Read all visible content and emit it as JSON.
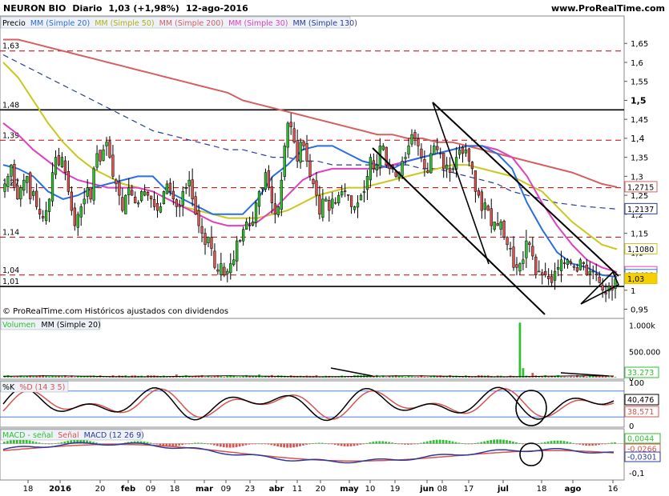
{
  "header": {
    "stock": "NEURON BIO",
    "period": "Diario",
    "quote": "1,03 (+1,98%)",
    "date": "12-ago-2016",
    "site": "www.ProRealTime.com"
  },
  "colors": {
    "up": "#2fbf2f",
    "down": "#d9534f",
    "ma20": "#2a6fe0",
    "ma50": "#c8c81e",
    "ma200": "#d46060",
    "ma30": "#e040c0",
    "ma130": "#2b3a9c",
    "level": "#c00000",
    "trend": "#000000"
  },
  "price_panel": {
    "legend": [
      "Precio",
      "MM (Simple 20)",
      "MM (Simple 50)",
      "MM (Simple 200)",
      "MM (Simple 30)",
      "MM (Simple 130)"
    ],
    "watermark": "© ProRealTime.com Históricos ajustados con dividendos",
    "levels": [
      {
        "label": "1,63",
        "value": 1.63,
        "style": "dashed"
      },
      {
        "label": "1,48",
        "value": 1.475,
        "style": "solid"
      },
      {
        "label": "1,39",
        "value": 1.395,
        "style": "dashed"
      },
      {
        "label": "1,27",
        "value": 1.27,
        "style": "dashed"
      },
      {
        "label": "1,14",
        "value": 1.14,
        "style": "dashed"
      },
      {
        "label": "1,04",
        "value": 1.04,
        "style": "dashed"
      },
      {
        "label": "1,01",
        "value": 1.01,
        "style": "solid"
      }
    ],
    "right_labels": [
      {
        "text": "1,2715",
        "value": 1.2715,
        "color": "#d46060"
      },
      {
        "text": "1,2137",
        "value": 1.2137,
        "color": "#2b3a9c"
      },
      {
        "text": "1,1080",
        "value": 1.108,
        "color": "#c8c81e"
      },
      {
        "text": "1,0477",
        "value": 1.0477,
        "color": "#e040c0"
      },
      {
        "text": "1,0400",
        "value": 1.04,
        "color": "#2a6fe0"
      },
      {
        "text": "1,03",
        "value": 1.03,
        "color": "#e8c000"
      }
    ]
  },
  "volume_panel": {
    "legend": [
      "Volumen",
      "MM (Simple 20)"
    ],
    "last": "33.273"
  },
  "stoch_panel": {
    "legend": [
      "%K",
      "%D (14 3 5)"
    ],
    "last_k": "40,476",
    "last_d": "38,571"
  },
  "macd_panel": {
    "legend": [
      "MACD - señal",
      "Señal",
      "MACD (12 26 9)"
    ],
    "hist_last": "0,0044",
    "signal_last": "-0,0266",
    "macd_last": "-0,0301"
  },
  "chart_data": [
    {
      "type": "candlestick",
      "title": "NEURON BIO Diario",
      "ylim": [
        0.93,
        1.68
      ],
      "yticks": [
        "1,65",
        "1,6",
        "1,55",
        "1,5",
        "1,45",
        "1,4",
        "1,35",
        "1,3",
        "1,25",
        "1,2",
        "1,15",
        "1,1",
        "1,05",
        "1",
        "0,95"
      ],
      "x_ticks": [
        "18",
        "2016",
        "20",
        "feb",
        "09",
        "18",
        "mar",
        "09",
        "23",
        "abr",
        "11",
        "20",
        "may",
        "10",
        "19",
        "jun",
        "08",
        "17",
        "jul",
        "18",
        "ago",
        "16"
      ],
      "close": [
        1.28,
        1.3,
        1.33,
        1.27,
        1.24,
        1.27,
        1.29,
        1.3,
        1.24,
        1.26,
        1.22,
        1.2,
        1.19,
        1.21,
        1.24,
        1.31,
        1.35,
        1.33,
        1.35,
        1.31,
        1.26,
        1.21,
        1.17,
        1.2,
        1.22,
        1.24,
        1.27,
        1.24,
        1.32,
        1.36,
        1.34,
        1.37,
        1.39,
        1.35,
        1.3,
        1.28,
        1.25,
        1.21,
        1.25,
        1.27,
        1.25,
        1.23,
        1.23,
        1.26,
        1.26,
        1.25,
        1.24,
        1.22,
        1.21,
        1.22,
        1.26,
        1.28,
        1.26,
        1.24,
        1.22,
        1.22,
        1.26,
        1.27,
        1.29,
        1.24,
        1.2,
        1.17,
        1.15,
        1.12,
        1.14,
        1.11,
        1.06,
        1.05,
        1.07,
        1.04,
        1.05,
        1.07,
        1.08,
        1.13,
        1.13,
        1.16,
        1.18,
        1.17,
        1.18,
        1.23,
        1.26,
        1.27,
        1.31,
        1.27,
        1.23,
        1.2,
        1.22,
        1.29,
        1.38,
        1.44,
        1.43,
        1.39,
        1.34,
        1.39,
        1.38,
        1.34,
        1.3,
        1.28,
        1.25,
        1.2,
        1.24,
        1.24,
        1.21,
        1.24,
        1.23,
        1.25,
        1.26,
        1.26,
        1.25,
        1.22,
        1.22,
        1.23,
        1.25,
        1.26,
        1.3,
        1.35,
        1.32,
        1.33,
        1.38,
        1.38,
        1.33,
        1.32,
        1.32,
        1.3,
        1.31,
        1.34,
        1.35,
        1.38,
        1.41,
        1.4,
        1.38,
        1.35,
        1.32,
        1.31,
        1.36,
        1.38,
        1.37,
        1.36,
        1.32,
        1.33,
        1.31,
        1.32,
        1.35,
        1.37,
        1.36,
        1.37,
        1.34,
        1.32,
        1.26,
        1.25,
        1.21,
        1.23,
        1.21,
        1.17,
        1.18,
        1.17,
        1.18,
        1.14,
        1.12,
        1.11,
        1.06,
        1.06,
        1.07,
        1.08,
        1.13,
        1.12,
        1.09,
        1.04,
        1.05,
        1.04,
        1.04,
        1.03,
        1.02,
        1.05,
        1.06,
        1.08,
        1.07,
        1.08,
        1.07,
        1.06,
        1.05,
        1.08,
        1.07,
        1.04,
        1.05,
        1.05,
        1.04,
        1.02,
        1.0,
        0.99,
        1.01,
        1.0,
        1.03
      ],
      "open_close_markers": "candles colored up/down",
      "moving_averages": {
        "ma20": [
          1.33,
          1.32,
          1.3,
          1.26,
          1.24,
          1.25,
          1.27,
          1.28,
          1.29,
          1.3,
          1.3,
          1.26,
          1.24,
          1.22,
          1.2,
          1.2,
          1.2,
          1.24,
          1.3,
          1.33,
          1.37,
          1.38,
          1.38,
          1.36,
          1.34,
          1.33,
          1.32,
          1.34,
          1.35,
          1.36,
          1.37,
          1.38,
          1.38,
          1.36,
          1.32,
          1.23,
          1.16,
          1.1,
          1.07,
          1.06,
          1.04,
          1.035
        ],
        "ma30": [
          1.44,
          1.41,
          1.37,
          1.34,
          1.31,
          1.29,
          1.28,
          1.27,
          1.27,
          1.27,
          1.26,
          1.24,
          1.22,
          1.2,
          1.18,
          1.17,
          1.17,
          1.18,
          1.21,
          1.25,
          1.29,
          1.31,
          1.32,
          1.32,
          1.32,
          1.32,
          1.33,
          1.34,
          1.35,
          1.36,
          1.37,
          1.38,
          1.38,
          1.37,
          1.35,
          1.3,
          1.23,
          1.17,
          1.12,
          1.08,
          1.06,
          1.0477
        ],
        "ma50": [
          1.6,
          1.56,
          1.5,
          1.44,
          1.39,
          1.35,
          1.32,
          1.3,
          1.28,
          1.27,
          1.26,
          1.24,
          1.22,
          1.21,
          1.2,
          1.19,
          1.19,
          1.19,
          1.2,
          1.21,
          1.23,
          1.25,
          1.26,
          1.27,
          1.27,
          1.28,
          1.29,
          1.3,
          1.31,
          1.32,
          1.33,
          1.33,
          1.32,
          1.31,
          1.3,
          1.28,
          1.26,
          1.22,
          1.18,
          1.15,
          1.12,
          1.108
        ],
        "ma130": [
          1.62,
          1.6,
          1.58,
          1.56,
          1.54,
          1.52,
          1.5,
          1.48,
          1.46,
          1.44,
          1.42,
          1.41,
          1.4,
          1.39,
          1.38,
          1.37,
          1.37,
          1.36,
          1.35,
          1.35,
          1.34,
          1.34,
          1.33,
          1.33,
          1.33,
          1.33,
          1.33,
          1.33,
          1.32,
          1.32,
          1.31,
          1.3,
          1.29,
          1.28,
          1.26,
          1.25,
          1.24,
          1.23,
          1.225,
          1.22,
          1.217,
          1.2137
        ],
        "ma200": [
          1.66,
          1.66,
          1.65,
          1.64,
          1.63,
          1.62,
          1.61,
          1.6,
          1.59,
          1.58,
          1.57,
          1.56,
          1.55,
          1.54,
          1.53,
          1.52,
          1.5,
          1.49,
          1.48,
          1.47,
          1.46,
          1.45,
          1.44,
          1.43,
          1.42,
          1.41,
          1.41,
          1.4,
          1.4,
          1.39,
          1.39,
          1.38,
          1.37,
          1.36,
          1.35,
          1.34,
          1.33,
          1.32,
          1.31,
          1.295,
          1.28,
          1.2715
        ]
      }
    },
    {
      "type": "bar",
      "title": "Volumen",
      "ylim": [
        0,
        1100000
      ],
      "yticks": [
        "1.000k",
        "500.000",
        "0"
      ]
    },
    {
      "type": "line",
      "title": "%K %D (14 3 5)",
      "ylim": [
        0,
        100
      ],
      "yticks": [
        "100",
        "0"
      ]
    },
    {
      "type": "line",
      "title": "MACD (12 26 9)",
      "ylim": [
        -0.12,
        0.04
      ],
      "yticks": [
        "0",
        "-0,1"
      ]
    }
  ]
}
